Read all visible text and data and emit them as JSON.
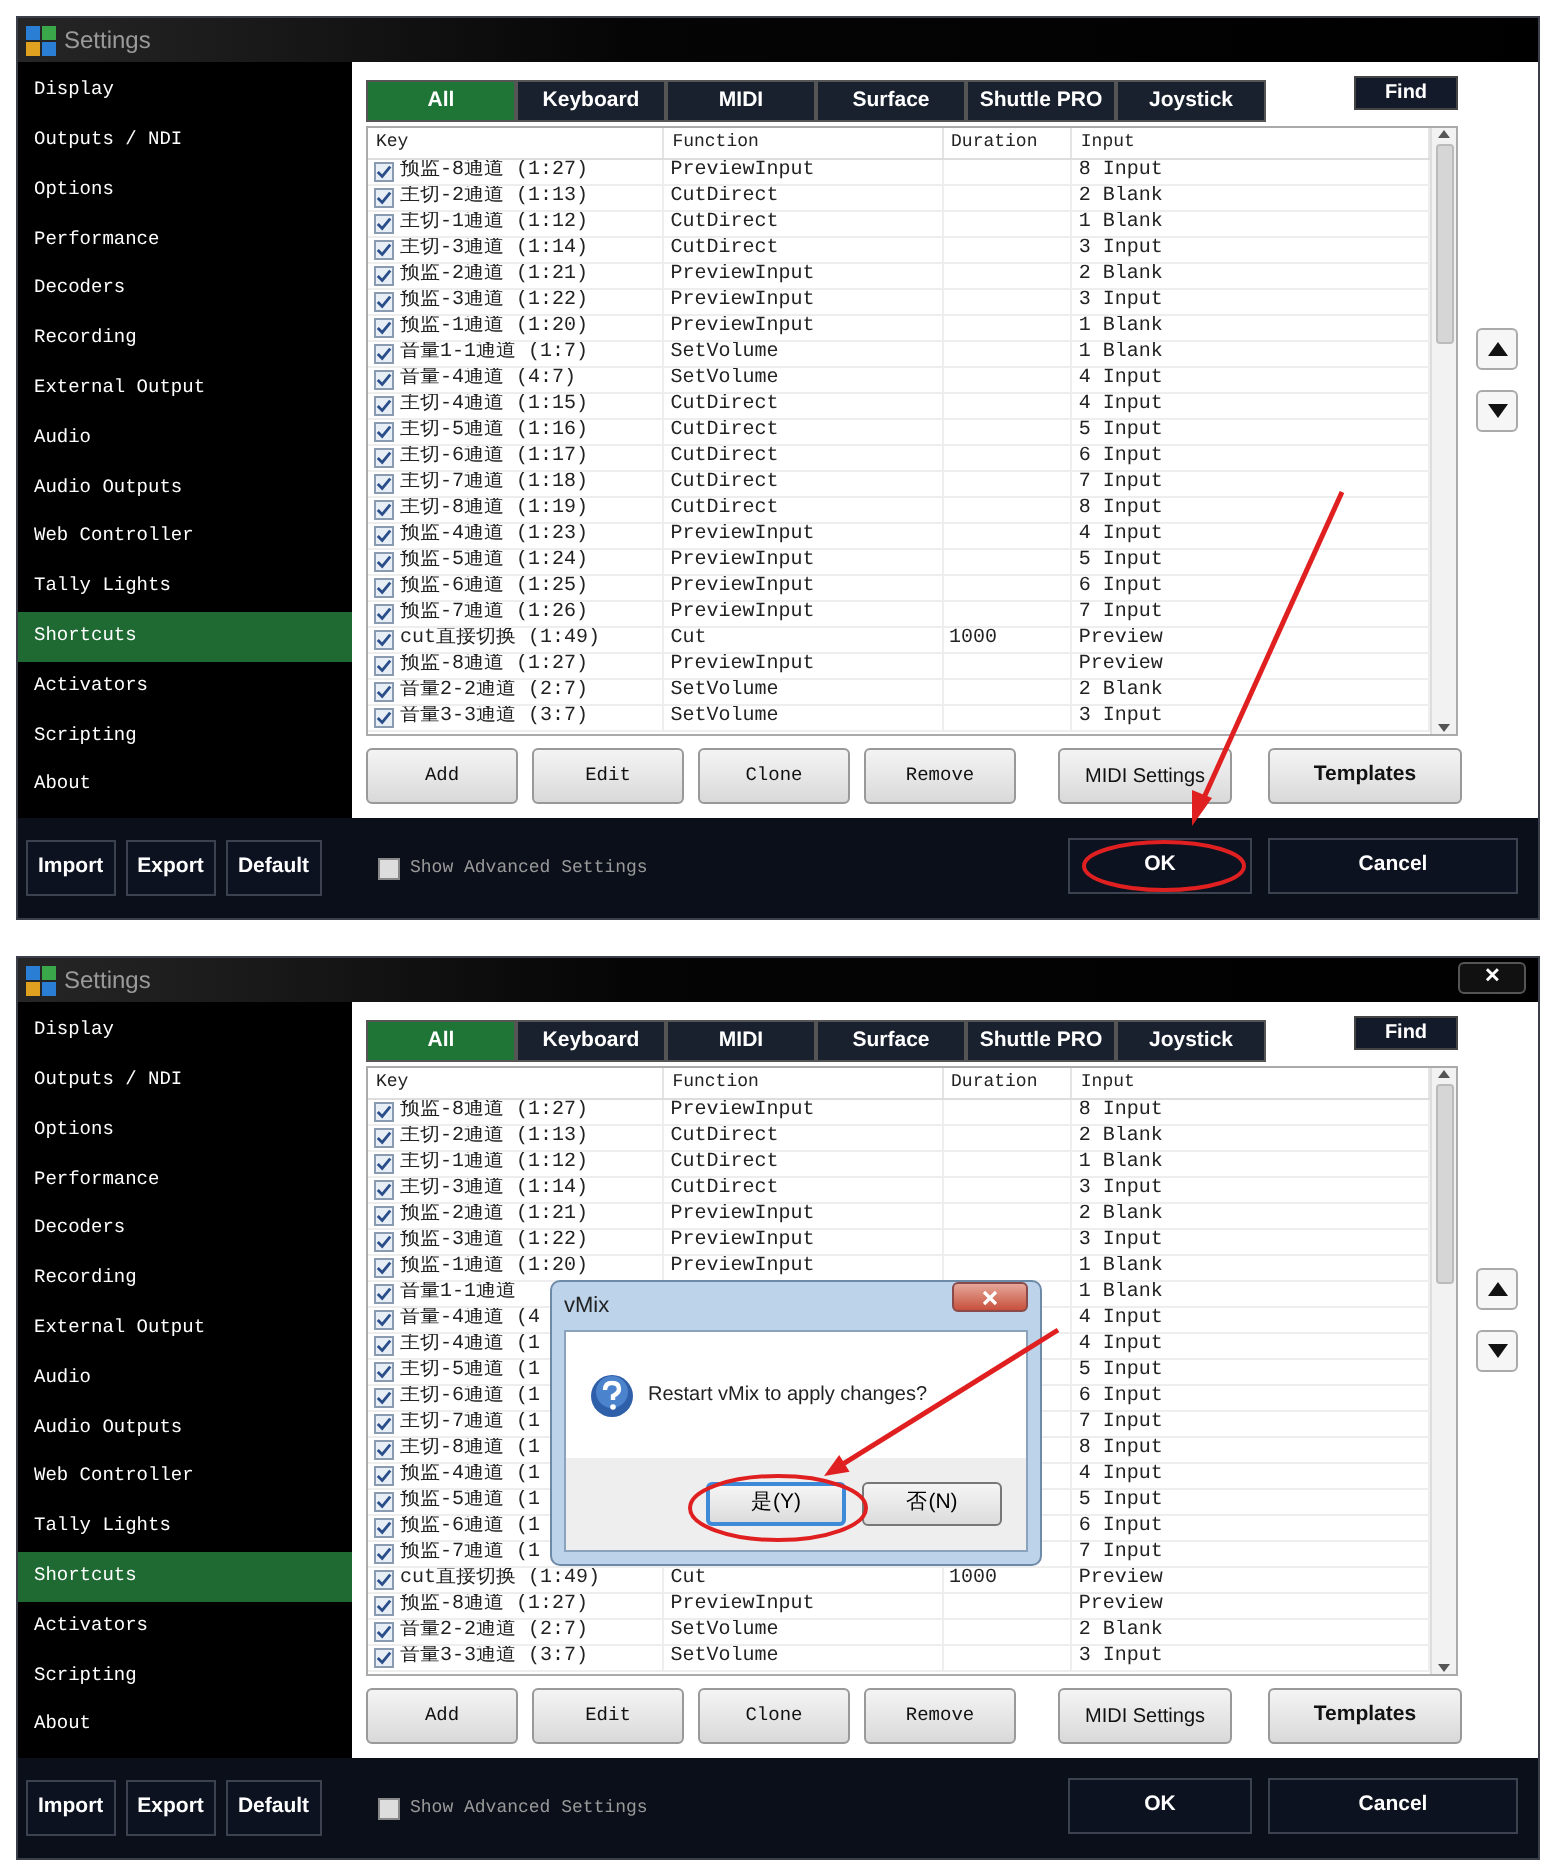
{
  "panels": [
    {
      "window": {
        "title": "Settings"
      },
      "sidebar": [
        {
          "label": "Display",
          "selected": false
        },
        {
          "label": "Outputs / NDI",
          "selected": false
        },
        {
          "label": "Options",
          "selected": false
        },
        {
          "label": "Performance",
          "selected": false
        },
        {
          "label": "Decoders",
          "selected": false
        },
        {
          "label": "Recording",
          "selected": false
        },
        {
          "label": "External Output",
          "selected": false
        },
        {
          "label": "Audio",
          "selected": false
        },
        {
          "label": "Audio Outputs",
          "selected": false
        },
        {
          "label": "Web Controller",
          "selected": false
        },
        {
          "label": "Tally Lights",
          "selected": false
        },
        {
          "label": "Shortcuts",
          "selected": true
        },
        {
          "label": "Activators",
          "selected": false
        },
        {
          "label": "Scripting",
          "selected": false
        },
        {
          "label": "About",
          "selected": false
        }
      ],
      "tabs": [
        {
          "label": "All",
          "selected": true
        },
        {
          "label": "Keyboard",
          "selected": false
        },
        {
          "label": "MIDI",
          "selected": false
        },
        {
          "label": "Surface",
          "selected": false
        },
        {
          "label": "Shuttle PRO",
          "selected": false
        },
        {
          "label": "Joystick",
          "selected": false
        }
      ],
      "find_button": "Find",
      "columns": [
        "Key",
        "Function",
        "Duration",
        "Input"
      ],
      "rows": [
        {
          "checked": true,
          "key": "预监-8通道 (1:27)",
          "function": "PreviewInput",
          "input": "8 Input"
        },
        {
          "checked": true,
          "key": "主切-2通道 (1:13)",
          "function": "CutDirect",
          "input": "2 Blank"
        },
        {
          "checked": true,
          "key": "主切-1通道 (1:12)",
          "function": "CutDirect",
          "input": "1 Blank"
        },
        {
          "checked": true,
          "key": "主切-3通道 (1:14)",
          "function": "CutDirect",
          "input": "3 Input"
        },
        {
          "checked": true,
          "key": "预监-2通道 (1:21)",
          "function": "PreviewInput",
          "input": "2 Blank"
        },
        {
          "checked": true,
          "key": "预监-3通道 (1:22)",
          "function": "PreviewInput",
          "input": "3 Input"
        },
        {
          "checked": true,
          "key": "预监-1通道 (1:20)",
          "function": "PreviewInput",
          "input": "1 Blank"
        },
        {
          "checked": true,
          "key": "音量1-1通道 (1:7)",
          "function": "SetVolume",
          "input": "1 Blank"
        },
        {
          "checked": true,
          "key": "音量-4通道 (4:7)",
          "function": "SetVolume",
          "input": "4 Input"
        },
        {
          "checked": true,
          "key": "主切-4通道 (1:15)",
          "function": "CutDirect",
          "input": "4 Input"
        },
        {
          "checked": true,
          "key": "主切-5通道 (1:16)",
          "function": "CutDirect",
          "input": "5 Input"
        },
        {
          "checked": true,
          "key": "主切-6通道 (1:17)",
          "function": "CutDirect",
          "input": "6 Input"
        },
        {
          "checked": true,
          "key": "主切-7通道 (1:18)",
          "function": "CutDirect",
          "input": "7 Input"
        },
        {
          "checked": true,
          "key": "主切-8通道 (1:19)",
          "function": "CutDirect",
          "input": "8 Input"
        },
        {
          "checked": true,
          "key": "预监-4通道 (1:23)",
          "function": "PreviewInput",
          "input": "4 Input"
        },
        {
          "checked": true,
          "key": "预监-5通道 (1:24)",
          "function": "PreviewInput",
          "input": "5 Input"
        },
        {
          "checked": true,
          "key": "预监-6通道 (1:25)",
          "function": "PreviewInput",
          "input": "6 Input"
        },
        {
          "checked": true,
          "key": "预监-7通道 (1:26)",
          "function": "PreviewInput",
          "input": "7 Input"
        },
        {
          "checked": true,
          "key": "cut直接切换 (1:49)",
          "function": "Cut",
          "duration": "1000",
          "input": "Preview"
        },
        {
          "checked": true,
          "key": "预监-8通道 (1:27)",
          "function": "PreviewInput",
          "input": "Preview"
        },
        {
          "checked": true,
          "key": "音量2-2通道 (2:7)",
          "function": "SetVolume",
          "input": "2 Blank"
        },
        {
          "checked": true,
          "key": "音量3-3通道 (3:7)",
          "function": "SetVolume",
          "input": "3 Input"
        }
      ],
      "list_buttons": [
        {
          "label": "Add",
          "kind": "command"
        },
        {
          "label": "Edit",
          "kind": "command"
        },
        {
          "label": "Clone",
          "kind": "command"
        },
        {
          "label": "Remove",
          "kind": "command"
        },
        {
          "label": "MIDI Settings",
          "kind": "setting"
        },
        {
          "label": "Templates",
          "kind": "template"
        }
      ],
      "side_buttons": [
        "Import",
        "Export",
        "Default"
      ],
      "advanced": {
        "label": "Show Advanced Settings",
        "checked": false
      },
      "ok_button": "OK",
      "cancel_button": "Cancel"
    },
    {
      "window": {
        "title": "Settings",
        "close_button": "✕"
      },
      "sidebar": [
        {
          "label": "Display",
          "selected": false
        },
        {
          "label": "Outputs / NDI",
          "selected": false
        },
        {
          "label": "Options",
          "selected": false
        },
        {
          "label": "Performance",
          "selected": false
        },
        {
          "label": "Decoders",
          "selected": false
        },
        {
          "label": "Recording",
          "selected": false
        },
        {
          "label": "External Output",
          "selected": false
        },
        {
          "label": "Audio",
          "selected": false
        },
        {
          "label": "Audio Outputs",
          "selected": false
        },
        {
          "label": "Web Controller",
          "selected": false
        },
        {
          "label": "Tally Lights",
          "selected": false
        },
        {
          "label": "Shortcuts",
          "selected": true
        },
        {
          "label": "Activators",
          "selected": false
        },
        {
          "label": "Scripting",
          "selected": false
        },
        {
          "label": "About",
          "selected": false
        }
      ],
      "tabs": [
        {
          "label": "All",
          "selected": true
        },
        {
          "label": "Keyboard",
          "selected": false
        },
        {
          "label": "MIDI",
          "selected": false
        },
        {
          "label": "Surface",
          "selected": false
        },
        {
          "label": "Shuttle PRO",
          "selected": false
        },
        {
          "label": "Joystick",
          "selected": false
        }
      ],
      "find_button": "Find",
      "columns": [
        "Key",
        "Function",
        "Duration",
        "Input"
      ],
      "rows": [
        {
          "checked": true,
          "key": "预监-8通道 (1:27)",
          "function": "PreviewInput",
          "input": "8 Input"
        },
        {
          "checked": true,
          "key": "主切-2通道 (1:13)",
          "function": "CutDirect",
          "input": "2 Blank"
        },
        {
          "checked": true,
          "key": "主切-1通道 (1:12)",
          "function": "CutDirect",
          "input": "1 Blank"
        },
        {
          "checked": true,
          "key": "主切-3通道 (1:14)",
          "function": "CutDirect",
          "input": "3 Input"
        },
        {
          "checked": true,
          "key": "预监-2通道 (1:21)",
          "function": "PreviewInput",
          "input": "2 Blank"
        },
        {
          "checked": true,
          "key": "预监-3通道 (1:22)",
          "function": "PreviewInput",
          "input": "3 Input"
        },
        {
          "checked": true,
          "key": "预监-1通道 (1:20)",
          "function": "PreviewInput",
          "input": "1 Blank"
        },
        {
          "checked": true,
          "key": "音量1-1通道",
          "input": "1 Blank"
        },
        {
          "checked": true,
          "key": "音量-4通道 (4",
          "input": "4 Input"
        },
        {
          "checked": true,
          "key": "主切-4通道 (1",
          "input": "4 Input"
        },
        {
          "checked": true,
          "key": "主切-5通道 (1",
          "input": "5 Input"
        },
        {
          "checked": true,
          "key": "主切-6通道 (1",
          "input": "6 Input"
        },
        {
          "checked": true,
          "key": "主切-7通道 (1",
          "input": "7 Input"
        },
        {
          "checked": true,
          "key": "主切-8通道 (1",
          "input": "8 Input"
        },
        {
          "checked": true,
          "key": "预监-4通道 (1",
          "input": "4 Input"
        },
        {
          "checked": true,
          "key": "预监-5通道 (1",
          "input": "5 Input"
        },
        {
          "checked": true,
          "key": "预监-6通道 (1",
          "input": "6 Input"
        },
        {
          "checked": true,
          "key": "预监-7通道 (1",
          "input": "7 Input"
        },
        {
          "checked": true,
          "key": "cut直接切换 (1:49)",
          "function": "Cut",
          "duration": "1000",
          "input": "Preview"
        },
        {
          "checked": true,
          "key": "预监-8通道 (1:27)",
          "function": "PreviewInput",
          "input": "Preview"
        },
        {
          "checked": true,
          "key": "音量2-2通道 (2:7)",
          "function": "SetVolume",
          "input": "2 Blank"
        },
        {
          "checked": true,
          "key": "音量3-3通道 (3:7)",
          "function": "SetVolume",
          "input": "3 Input"
        }
      ],
      "list_buttons": [
        {
          "label": "Add",
          "kind": "command"
        },
        {
          "label": "Edit",
          "kind": "command"
        },
        {
          "label": "Clone",
          "kind": "command"
        },
        {
          "label": "Remove",
          "kind": "command"
        },
        {
          "label": "MIDI Settings",
          "kind": "setting"
        },
        {
          "label": "Templates",
          "kind": "template"
        }
      ],
      "side_buttons": [
        "Import",
        "Export",
        "Default"
      ],
      "advanced": {
        "label": "Show Advanced Settings",
        "checked": false
      },
      "ok_button": "OK",
      "cancel_button": "Cancel",
      "dialog": {
        "title": "vMix",
        "message": "Restart vMix to apply changes?",
        "buttons": [
          {
            "label": "是(Y)",
            "selected": true
          },
          {
            "label": "否(N)",
            "selected": false
          }
        ]
      }
    }
  ]
}
